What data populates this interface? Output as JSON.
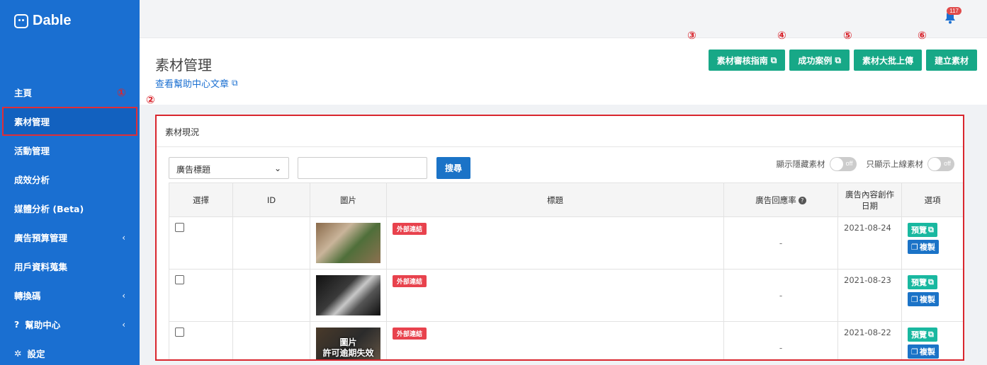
{
  "brand": {
    "name": "Dable"
  },
  "sidebar": {
    "items": [
      {
        "label": "主頁",
        "chevron": false,
        "icon": ""
      },
      {
        "label": "素材管理",
        "chevron": false,
        "icon": "",
        "active": true
      },
      {
        "label": "活動管理",
        "chevron": false,
        "icon": ""
      },
      {
        "label": "成效分析",
        "chevron": false,
        "icon": ""
      },
      {
        "label": "媒體分析 (Beta)",
        "chevron": false,
        "icon": ""
      },
      {
        "label": "廣告預算管理",
        "chevron": true,
        "icon": ""
      },
      {
        "label": "用戶資料蒐集",
        "chevron": false,
        "icon": ""
      },
      {
        "label": "轉換碼",
        "chevron": true,
        "icon": ""
      },
      {
        "label": "幫助中心",
        "chevron": true,
        "icon": "?"
      },
      {
        "label": "設定",
        "chevron": false,
        "icon": "✲"
      }
    ],
    "chevron_glyph": "‹"
  },
  "topbar": {
    "notification_count": "117",
    "icon": "bell-icon"
  },
  "header": {
    "title": "素材管理",
    "help_link": "查看幫助中心文章",
    "buttons": [
      {
        "label": "素材審核指南",
        "external": true
      },
      {
        "label": "成功案例",
        "external": true
      },
      {
        "label": "素材大批上傳",
        "external": false
      },
      {
        "label": "建立素材",
        "external": false
      }
    ]
  },
  "markers": [
    "①",
    "②",
    "③",
    "④",
    "⑤",
    "⑥"
  ],
  "panel": {
    "title": "素材現況",
    "filter": {
      "select_value": "廣告標題",
      "search_placeholder": "",
      "search_button": "搜尋",
      "toggle_hidden_label": "顯示隱藏素材",
      "toggle_online_label": "只顯示上線素材",
      "toggle_state": "off"
    },
    "table": {
      "headers": [
        "選擇",
        "ID",
        "圖片",
        "標題",
        "廣告回應率",
        "廣告內容創作日期",
        "選項"
      ],
      "rows": [
        {
          "id": "",
          "tag": "外部連結",
          "rate": "-",
          "date": "2021-08-24",
          "thumb_text": "",
          "preview": "預覽",
          "copy": "複製"
        },
        {
          "id": "",
          "tag": "外部連結",
          "rate": "-",
          "date": "2021-08-23",
          "thumb_text": "",
          "preview": "預覽",
          "copy": "複製"
        },
        {
          "id": "",
          "tag": "外部連結",
          "rate": "-",
          "date": "2021-08-22",
          "thumb_text": "圖片\n許可逾期失效",
          "preview": "預覽",
          "copy": "複製"
        }
      ]
    }
  },
  "colors": {
    "sidebar": "#1a6fd1",
    "accent_green": "#17a887",
    "accent_blue": "#1b73c7",
    "tag_red": "#e8424d",
    "annotation_red": "#d9262e"
  }
}
